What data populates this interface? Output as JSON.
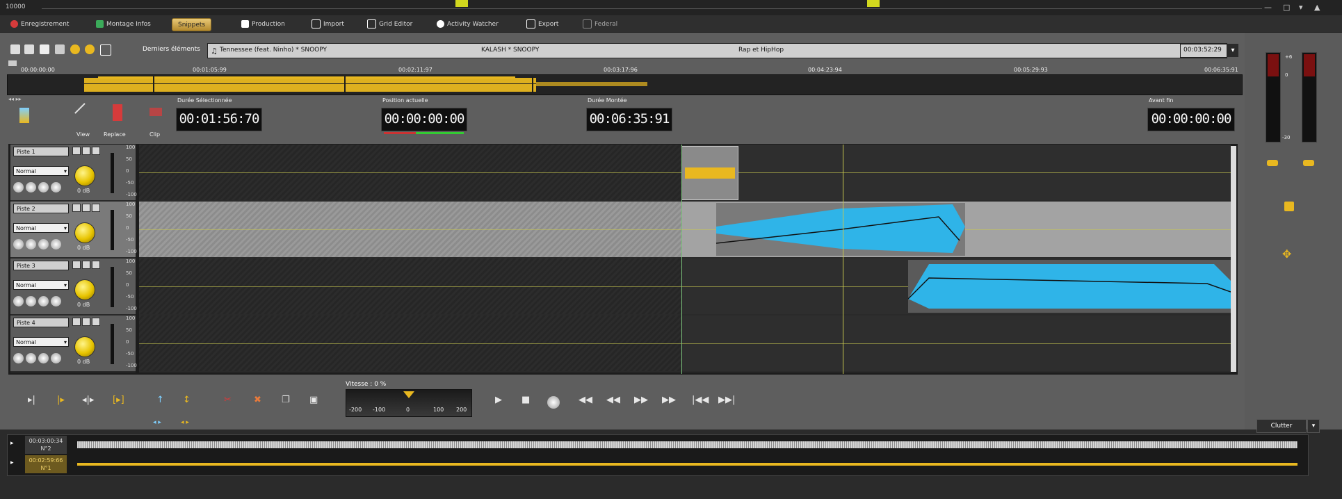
{
  "window": {
    "title": "10000"
  },
  "tabs": [
    {
      "label": "Enregistrement",
      "icon": "record-icon",
      "color": "#d63b3b"
    },
    {
      "label": "Montage Infos",
      "icon": "montage-icon",
      "color": "#3bab5a"
    },
    {
      "label": "Snippets",
      "icon": "snippets-icon",
      "color": "#b48a2e"
    },
    {
      "label": "Production",
      "icon": "production-icon",
      "color": "#dddddd"
    },
    {
      "label": "Import",
      "icon": "import-icon",
      "color": "#dddddd"
    },
    {
      "label": "Grid Editor",
      "icon": "grid-icon",
      "color": "#dddddd"
    },
    {
      "label": "Activity Watcher",
      "icon": "watcher-icon",
      "color": "#dddddd"
    },
    {
      "label": "Export",
      "icon": "export-icon",
      "color": "#dddddd"
    },
    {
      "label": "Federal",
      "icon": "federal-icon",
      "color": "#888888"
    }
  ],
  "toolbar": {
    "recent_label": "Derniers éléments",
    "recent_title": "Tennessee (feat. Ninho) * SNOOPY",
    "recent_artist": "KALASH * SNOOPY",
    "recent_genre": "Rap et HipHop",
    "recent_time": "00:03:52:29"
  },
  "overview": {
    "ticks": [
      "00:00:00:00",
      "00:01:05:99",
      "00:02:11:97",
      "00:03:17:96",
      "00:04:23:94",
      "00:05:29:93",
      "00:06:35:91"
    ]
  },
  "info": {
    "view_label": "View",
    "replace_label": "Replace",
    "clip_label": "Clip",
    "selected_duration_label": "Durée Sélectionnée",
    "selected_duration": "00:01:56:70",
    "current_position_label": "Position actuelle",
    "current_position": "00:00:00:00",
    "total_duration_label": "Durée Montée",
    "total_duration": "00:06:35:91",
    "before_end_label": "Avant fin",
    "before_end": "00:00:00:00"
  },
  "tracks": [
    {
      "name": "Piste 1",
      "mode": "Normal",
      "db": "0 dB"
    },
    {
      "name": "Piste 2",
      "mode": "Normal",
      "db": "0 dB"
    },
    {
      "name": "Piste 3",
      "mode": "Normal",
      "db": "0 dB"
    },
    {
      "name": "Piste 4",
      "mode": "Normal",
      "db": "0 dB"
    }
  ],
  "scale_labels": [
    "100",
    "50",
    "0",
    "-50",
    "-100"
  ],
  "transport": {
    "speed_label": "Vitesse : 0 %",
    "speed_ticks": [
      "-200",
      "-100",
      "0",
      "100",
      "200"
    ],
    "speed_value": 0
  },
  "meters": {
    "labels": [
      "+6",
      "0",
      "-30"
    ]
  },
  "bottom": {
    "cluster_label": "Clutter",
    "rows": [
      {
        "time": "00:03:00:34",
        "num": "N°2"
      },
      {
        "time": "00:02:59:66",
        "num": "N°1"
      }
    ]
  },
  "colors": {
    "accent": "#e9b820",
    "waveform_blue": "#2fb4e8",
    "marker_yellow": "#d2d81e"
  }
}
